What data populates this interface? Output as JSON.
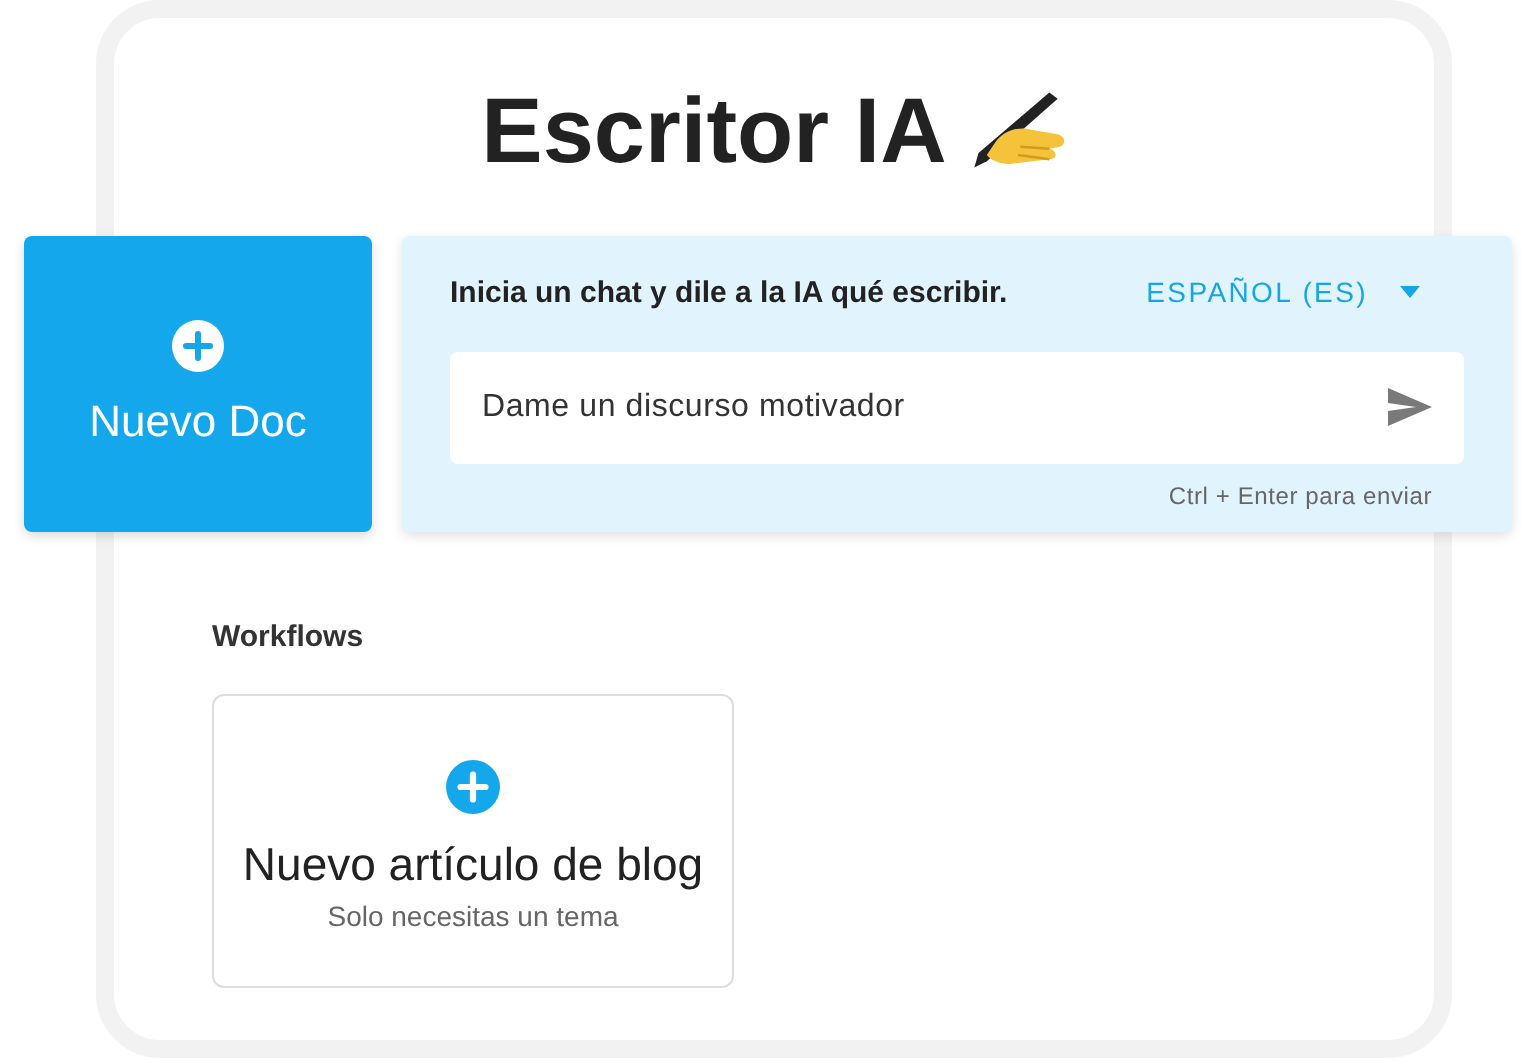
{
  "title": "Escritor IA",
  "new_doc": {
    "label": "Nuevo Doc"
  },
  "chat": {
    "prompt": "Inicia un chat y dile a la IA qué escribir.",
    "language": "ESPAÑOL (ES)",
    "input_value": "Dame un discurso motivador",
    "hint": "Ctrl + Enter para enviar"
  },
  "workflows": {
    "heading": "Workflows",
    "items": [
      {
        "title": "Nuevo artículo de blog",
        "subtitle": "Solo necesitas un tema"
      }
    ]
  }
}
